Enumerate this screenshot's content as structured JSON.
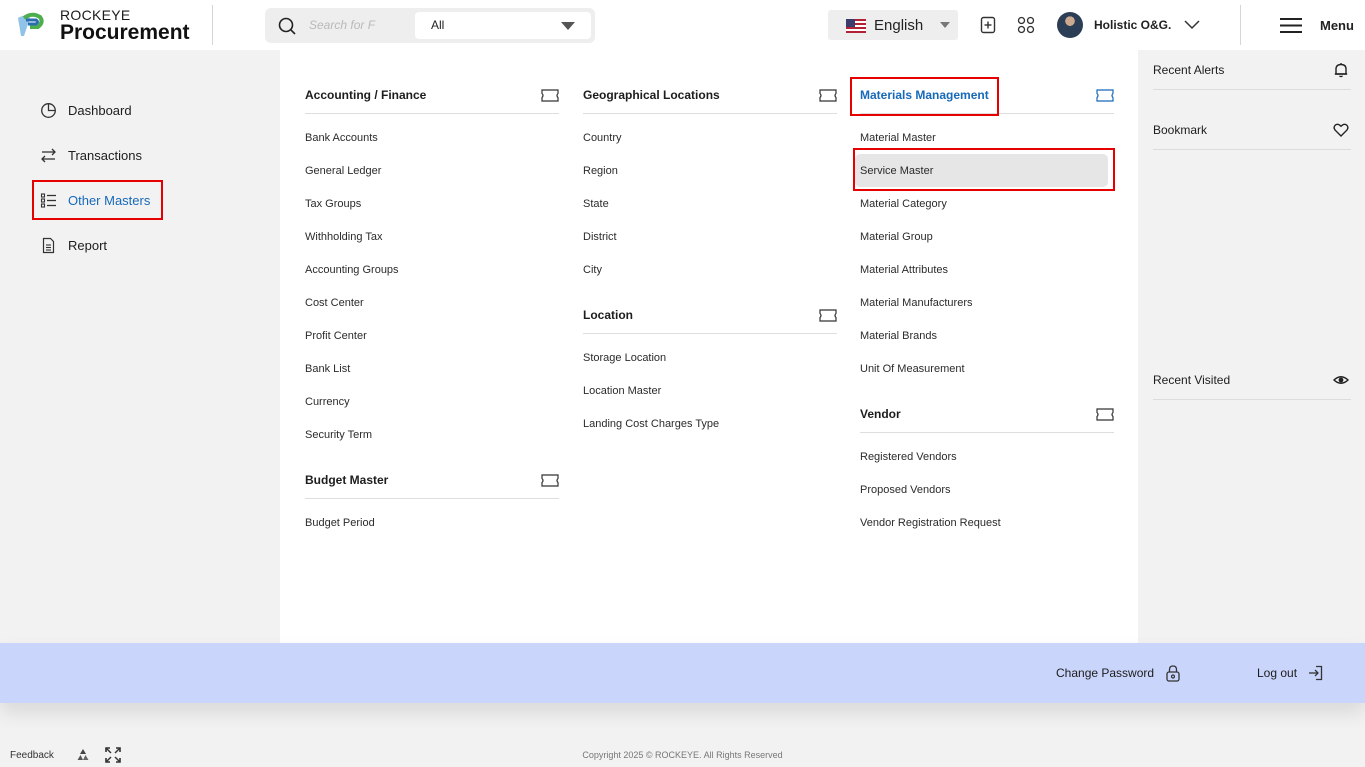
{
  "brand": {
    "top": "ROCKEYE",
    "main": "Procurement"
  },
  "search": {
    "placeholder": "Search for F",
    "scope": "All"
  },
  "language": {
    "label": "English"
  },
  "user": {
    "name": "Holistic O&G."
  },
  "menu": {
    "label": "Menu"
  },
  "sidebar": {
    "items": [
      {
        "label": "Dashboard",
        "icon": "pie-chart-icon"
      },
      {
        "label": "Transactions",
        "icon": "swap-arrows-icon"
      },
      {
        "label": "Other Masters",
        "icon": "list-icon",
        "active": true
      },
      {
        "label": "Report",
        "icon": "document-icon"
      }
    ]
  },
  "mega_menu": {
    "accounting": {
      "title": "Accounting / Finance",
      "links": [
        "Bank Accounts",
        "General Ledger",
        "Tax Groups",
        "Withholding Tax",
        "Accounting Groups",
        "Cost Center",
        "Profit Center",
        "Bank List",
        "Currency",
        "Security Term"
      ]
    },
    "budget": {
      "title": "Budget Master",
      "links": [
        "Budget Period"
      ]
    },
    "geo": {
      "title": "Geographical Locations",
      "links": [
        "Country",
        "Region",
        "State",
        "District",
        "City"
      ]
    },
    "location": {
      "title": "Location",
      "links": [
        "Storage Location",
        "Location Master",
        "Landing Cost Charges Type"
      ]
    },
    "materials": {
      "title": "Materials Management",
      "links": [
        "Material Master",
        "Service Master",
        "Material Category",
        "Material Group",
        "Material Attributes",
        "Material Manufacturers",
        "Material Brands",
        "Unit Of Measurement"
      ]
    },
    "vendor": {
      "title": "Vendor",
      "links": [
        "Registered Vendors",
        "Proposed Vendors",
        "Vendor Registration Request"
      ]
    }
  },
  "right_panel": {
    "recent_alerts": "Recent Alerts",
    "bookmark": "Bookmark",
    "recent_visited": "Recent Visited"
  },
  "bottom_bar": {
    "change_password": "Change Password",
    "log_out": "Log out"
  },
  "footer": {
    "feedback": "Feedback",
    "copyright": "Copyright 2025 © ROCKEYE. All Rights Reserved"
  },
  "colors": {
    "accent_blue": "#1769b9",
    "highlight_red": "#e60000",
    "bottom_bar": "#c9d5fb"
  }
}
